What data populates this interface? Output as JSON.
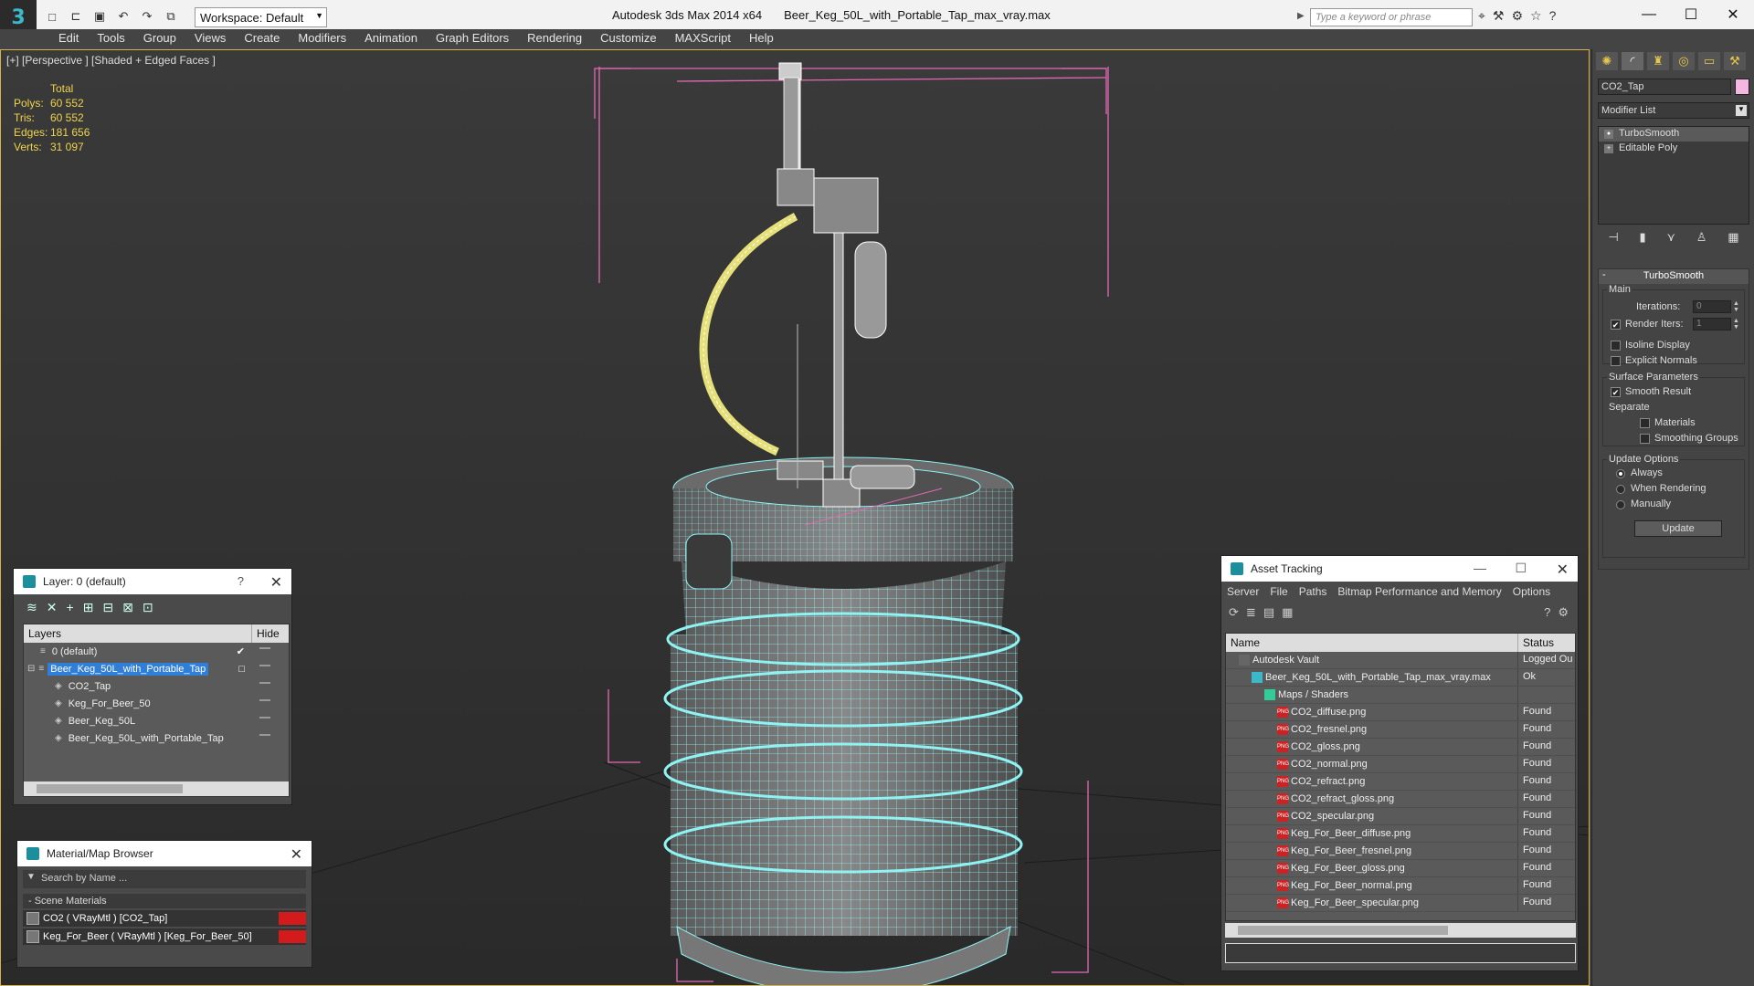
{
  "window": {
    "app_title": "Autodesk 3ds Max  2014 x64",
    "file_title": "Beer_Keg_50L_with_Portable_Tap_max_vray.max",
    "workspace": "Workspace: Default",
    "search_placeholder": "Type a keyword or phrase"
  },
  "menu": [
    "Edit",
    "Tools",
    "Group",
    "Views",
    "Create",
    "Modifiers",
    "Animation",
    "Graph Editors",
    "Rendering",
    "Customize",
    "MAXScript",
    "Help"
  ],
  "viewport": {
    "label": "[+] [Perspective ] [Shaded + Edged Faces ]",
    "stats": {
      "header": "Total",
      "rows": [
        {
          "label": "Polys:",
          "value": "60 552"
        },
        {
          "label": "Tris:",
          "value": "60 552"
        },
        {
          "label": "Edges:",
          "value": "181 656"
        },
        {
          "label": "Verts:",
          "value": "31 097"
        }
      ]
    }
  },
  "layer_panel": {
    "title": "Layer: 0 (default)",
    "help": "?",
    "col_layers": "Layers",
    "col_hide": "Hide",
    "rows": [
      {
        "name": "0 (default)",
        "level": 1,
        "checked": true,
        "selected": false
      },
      {
        "name": "Beer_Keg_50L_with_Portable_Tap",
        "level": 0,
        "checked": false,
        "selected": true
      },
      {
        "name": "CO2_Tap",
        "level": 2,
        "checked": false,
        "selected": false
      },
      {
        "name": "Keg_For_Beer_50",
        "level": 2,
        "checked": false,
        "selected": false
      },
      {
        "name": "Beer_Keg_50L",
        "level": 2,
        "checked": false,
        "selected": false
      },
      {
        "name": "Beer_Keg_50L_with_Portable_Tap",
        "level": 2,
        "checked": false,
        "selected": false
      }
    ]
  },
  "material_browser": {
    "title": "Material/Map Browser",
    "search_placeholder": "Search by Name ...",
    "section": "- Scene Materials",
    "materials": [
      "CO2  ( VRayMtl )  [CO2_Tap]",
      "Keg_For_Beer  ( VRayMtl )  [Keg_For_Beer_50]"
    ]
  },
  "asset_tracking": {
    "title": "Asset Tracking",
    "menu": [
      "Server",
      "File",
      "Paths",
      "Bitmap Performance and Memory",
      "Options"
    ],
    "col_name": "Name",
    "col_status": "Status",
    "rows": [
      {
        "name": "Autodesk Vault",
        "status": "Logged Ou",
        "indent": 1,
        "icon": "vault"
      },
      {
        "name": "Beer_Keg_50L_with_Portable_Tap_max_vray.max",
        "status": "Ok",
        "indent": 2,
        "icon": "max"
      },
      {
        "name": "Maps / Shaders",
        "status": "",
        "indent": 3,
        "icon": "maps"
      },
      {
        "name": "CO2_diffuse.png",
        "status": "Found",
        "indent": 4,
        "icon": "png"
      },
      {
        "name": "CO2_fresnel.png",
        "status": "Found",
        "indent": 4,
        "icon": "png"
      },
      {
        "name": "CO2_gloss.png",
        "status": "Found",
        "indent": 4,
        "icon": "png"
      },
      {
        "name": "CO2_normal.png",
        "status": "Found",
        "indent": 4,
        "icon": "png"
      },
      {
        "name": "CO2_refract.png",
        "status": "Found",
        "indent": 4,
        "icon": "png"
      },
      {
        "name": "CO2_refract_gloss.png",
        "status": "Found",
        "indent": 4,
        "icon": "png"
      },
      {
        "name": "CO2_specular.png",
        "status": "Found",
        "indent": 4,
        "icon": "png"
      },
      {
        "name": "Keg_For_Beer_diffuse.png",
        "status": "Found",
        "indent": 4,
        "icon": "png"
      },
      {
        "name": "Keg_For_Beer_fresnel.png",
        "status": "Found",
        "indent": 4,
        "icon": "png"
      },
      {
        "name": "Keg_For_Beer_gloss.png",
        "status": "Found",
        "indent": 4,
        "icon": "png"
      },
      {
        "name": "Keg_For_Beer_normal.png",
        "status": "Found",
        "indent": 4,
        "icon": "png"
      },
      {
        "name": "Keg_For_Beer_specular.png",
        "status": "Found",
        "indent": 4,
        "icon": "png"
      }
    ]
  },
  "command_panel": {
    "object_name": "CO2_Tap",
    "object_color": "#f4b7e0",
    "modifier_list": "Modifier List",
    "stack": [
      "TurboSmooth",
      "Editable Poly"
    ],
    "rollout_title": "TurboSmooth",
    "main_group": "Main",
    "iterations_label": "Iterations:",
    "iterations_value": "0",
    "render_iters_label": "Render Iters:",
    "render_iters_value": "1",
    "isoline": "Isoline Display",
    "explicit_normals": "Explicit Normals",
    "surface_group": "Surface Parameters",
    "smooth_result": "Smooth Result",
    "separate": "Separate",
    "materials": "Materials",
    "smoothing_groups": "Smoothing Groups",
    "update_group": "Update Options",
    "always": "Always",
    "when_rendering": "When Rendering",
    "manually": "Manually",
    "update_button": "Update"
  },
  "colors": {
    "accent": "#3bb9c9",
    "wire": "#8ff3f3",
    "hose": "#e6e07a",
    "selection": "#2f7ed8",
    "stats": "#f0d44b"
  }
}
